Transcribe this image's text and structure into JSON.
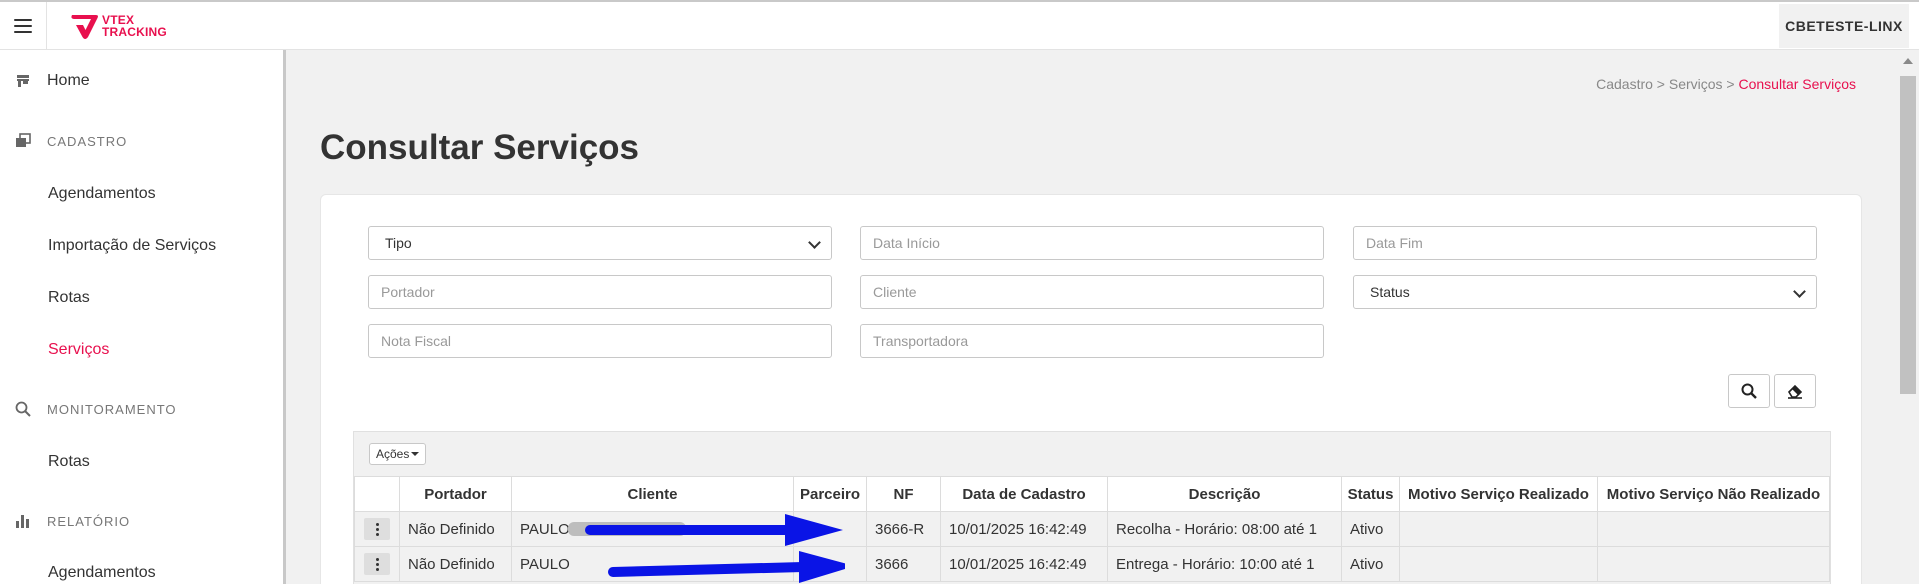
{
  "header": {
    "brand_line1": "VTEX",
    "brand_line2": "TRACKING",
    "account": "CBETESTE-LINX"
  },
  "sidebar": {
    "home": "Home",
    "sections": [
      {
        "label": "CADASTRO",
        "icon": "copy-icon",
        "items": [
          "Agendamentos",
          "Importação de Serviços",
          "Rotas",
          "Serviços"
        ]
      },
      {
        "label": "MONITORAMENTO",
        "icon": "search-icon",
        "items": [
          "Rotas"
        ]
      },
      {
        "label": "RELATÓRIO",
        "icon": "bar-chart-icon",
        "items": [
          "Agendamentos"
        ]
      }
    ],
    "active_item": "Serviços"
  },
  "breadcrumb": {
    "path": "Cadastro > Serviços > ",
    "current": "Consultar Serviços"
  },
  "page_title": "Consultar Serviços",
  "filters": {
    "tipo": "Tipo",
    "data_inicio": "Data Início",
    "data_fim": "Data Fim",
    "portador": "Portador",
    "cliente": "Cliente",
    "status": "Status",
    "nota_fiscal": "Nota Fiscal",
    "transportadora": "Transportadora"
  },
  "table": {
    "actions_label": "Ações",
    "columns": [
      "",
      "Portador",
      "Cliente",
      "Parceiro",
      "NF",
      "Data de Cadastro",
      "Descrição",
      "Status",
      "Motivo Serviço Realizado",
      "Motivo Serviço Não Realizado"
    ],
    "rows": [
      {
        "portador": "Não Definido",
        "cliente": "PAULO",
        "parceiro": "",
        "nf": "3666-R",
        "data": "10/01/2025 16:42:49",
        "descricao": "Recolha - Horário: 08:00 até 1",
        "status": "Ativo",
        "motivo_realizado": "",
        "motivo_nao_realizado": ""
      },
      {
        "portador": "Não Definido",
        "cliente": "PAULO",
        "parceiro": "",
        "nf": "3666",
        "data": "10/01/2025 16:42:49",
        "descricao": "Entrega - Horário: 10:00 até 1",
        "status": "Ativo",
        "motivo_realizado": "",
        "motivo_nao_realizado": ""
      }
    ]
  },
  "colors": {
    "brand": "#e8104e",
    "annotation_arrow": "#0a14e6"
  }
}
